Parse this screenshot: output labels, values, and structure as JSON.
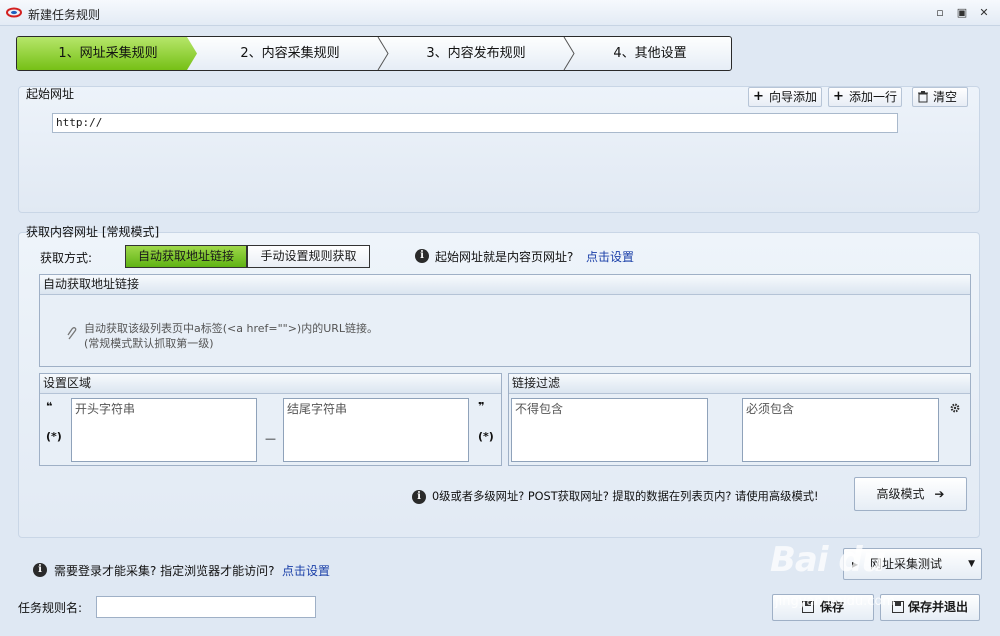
{
  "window": {
    "title": "新建任务规则",
    "min": "▫",
    "max": "▣",
    "close": "✕"
  },
  "wizard": {
    "steps": [
      "1、网址采集规则",
      "2、内容采集规则",
      "3、内容发布规则",
      "4、其他设置"
    ]
  },
  "start_url": {
    "section_title": "起始网址",
    "wizard_add": "向导添加",
    "add_row": "添加一行",
    "clear": "清空",
    "input_value": "http://"
  },
  "content_url": {
    "section_title": "获取内容网址 [常规模式]",
    "method_label": "获取方式:",
    "method_auto": "自动获取地址链接",
    "method_manual": "手动设置规则获取",
    "hint_text": "起始网址就是内容页网址?",
    "hint_link": "点击设置",
    "auto_box_title": "自动获取地址链接",
    "auto_desc_line1": "自动获取该级列表页中a标签(<a href=\"\">)内的URL链接。",
    "auto_desc_line2": "(常规模式默认抓取第一级)",
    "region_title": "设置区域",
    "start_placeholder": "开头字符串",
    "end_placeholder": "结尾字符串",
    "quote_open": "❝",
    "quote_close": "❞",
    "wildcard": "(*)",
    "dash": "—",
    "filter_title": "链接过滤",
    "exclude_placeholder": "不得包含",
    "include_placeholder": "必须包含",
    "advanced_hint": "0级或者多级网址? POST获取网址? 提取的数据在列表页内? 请使用高级模式!",
    "advanced_button": "高级模式"
  },
  "footer": {
    "login_hint": "需要登录才能采集? 指定浏览器才能访问?",
    "login_link": "点击设置",
    "test_dropdown": "网址采集测试",
    "rule_name_label": "任务规则名:",
    "rule_name_value": "",
    "save": "保存",
    "save_exit": "保存并退出"
  },
  "watermark": {
    "brand": "Bai du",
    "sub": "jingyan.baidu.com"
  }
}
